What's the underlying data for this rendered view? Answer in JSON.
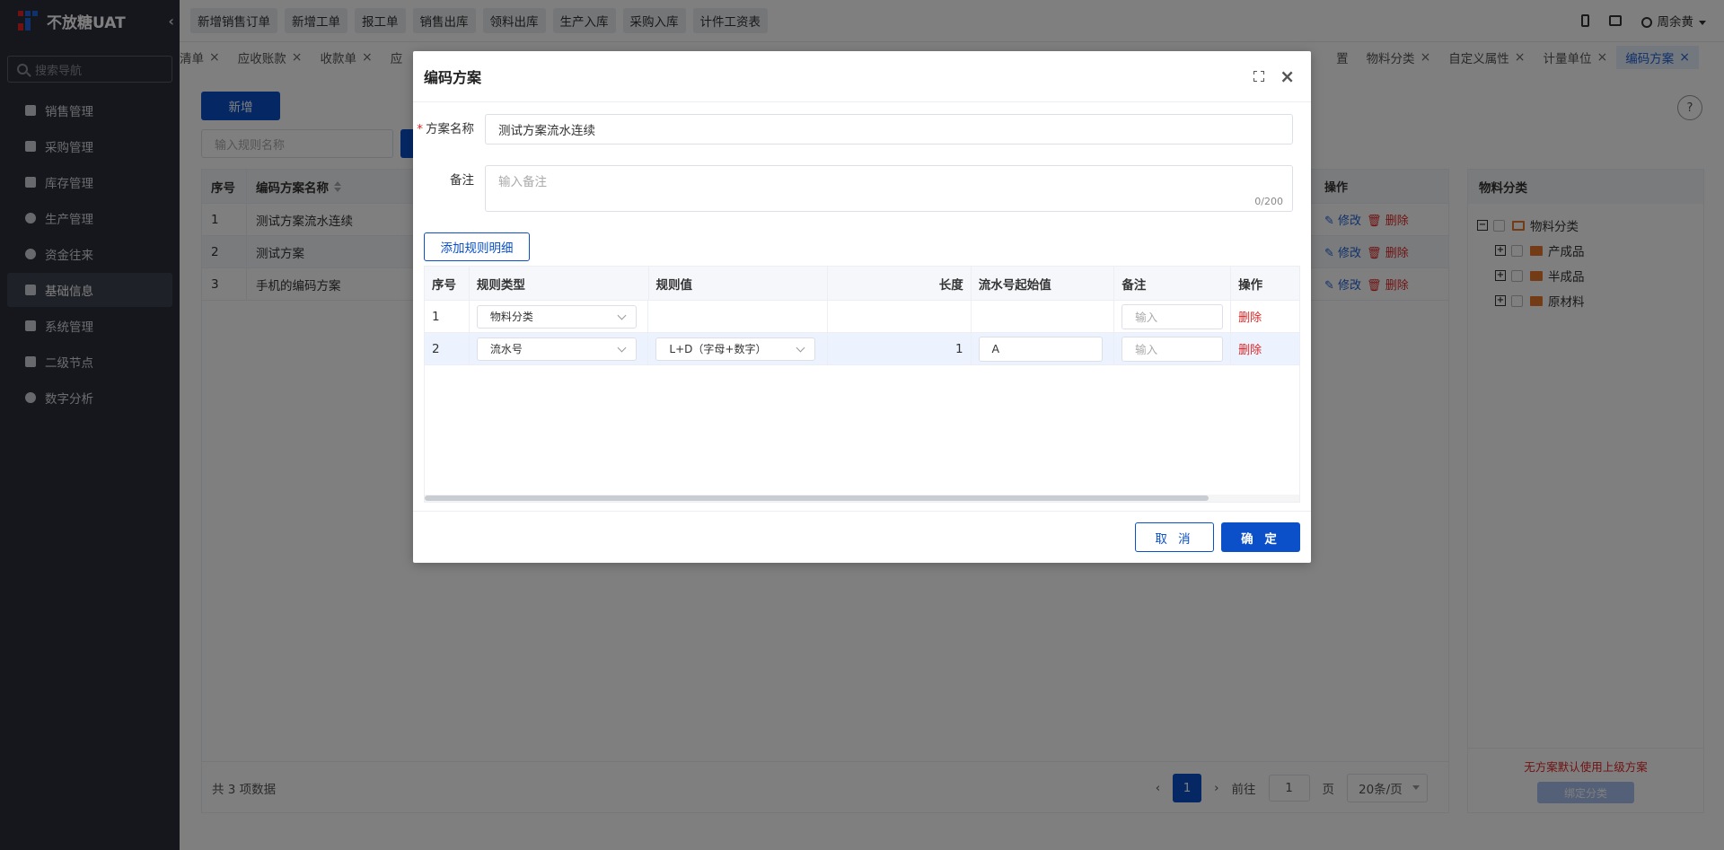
{
  "app": {
    "title": "不放糖UAT"
  },
  "sidebar": {
    "search_placeholder": "搜索导航",
    "items": [
      {
        "label": "销售管理",
        "icon": "tag-icon"
      },
      {
        "label": "采购管理",
        "icon": "cart-icon"
      },
      {
        "label": "库存管理",
        "icon": "warehouse-icon"
      },
      {
        "label": "生产管理",
        "icon": "production-icon"
      },
      {
        "label": "资金往来",
        "icon": "money-icon"
      },
      {
        "label": "基础信息",
        "icon": "grid-icon",
        "active": true
      },
      {
        "label": "系统管理",
        "icon": "apps-icon"
      },
      {
        "label": "二级节点",
        "icon": "document-icon"
      },
      {
        "label": "数字分析",
        "icon": "pie-chart-icon"
      }
    ]
  },
  "topbar": {
    "quick_buttons": [
      "新增销售订单",
      "新增工单",
      "报工单",
      "销售出库",
      "领料出库",
      "生产入库",
      "采购入库",
      "计件工资表"
    ],
    "user_name": "周余黄"
  },
  "tabs": {
    "items": [
      "清单",
      "应收账款",
      "收款单",
      "应",
      "置",
      "物料分类",
      "自定义属性",
      "计量单位",
      "编码方案"
    ],
    "active": "编码方案"
  },
  "main": {
    "add_button": "新增",
    "search_placeholder": "输入规则名称",
    "help": "?",
    "table": {
      "headers": {
        "no": "序号",
        "name": "编码方案名称",
        "op": "操作"
      },
      "rows": [
        {
          "no": "1",
          "name": "测试方案流水连续"
        },
        {
          "no": "2",
          "name": "测试方案"
        },
        {
          "no": "3",
          "name": "手机的编码方案"
        }
      ],
      "edit_label": "修改",
      "delete_label": "删除"
    },
    "footer": {
      "total": "共 3 项数据",
      "page": "1",
      "goto_prefix": "前往",
      "goto_value": "1",
      "goto_suffix": "页",
      "page_size": "20条/页"
    },
    "tree": {
      "title": "物料分类",
      "root": "物料分类",
      "children": [
        "产成品",
        "半成品",
        "原材料"
      ],
      "note": "无方案默认使用上级方案",
      "bind_button": "绑定分类"
    }
  },
  "dialog": {
    "title": "编码方案",
    "scheme_name_label": "方案名称",
    "scheme_name_value": "测试方案流水连续",
    "remark_label": "备注",
    "remark_placeholder": "输入备注",
    "remark_counter": "0/200",
    "add_rule_button": "添加规则明细",
    "rule_table": {
      "headers": {
        "no": "序号",
        "type": "规则类型",
        "value": "规则值",
        "length": "长度",
        "start": "流水号起始值",
        "remark": "备注",
        "op": "操作"
      },
      "rows": [
        {
          "no": "1",
          "type": "物料分类",
          "value": "",
          "length": "",
          "start": "",
          "remark_placeholder": "输入",
          "op": "删除"
        },
        {
          "no": "2",
          "type": "流水号",
          "value": "L+D（字母+数字）",
          "length": "1",
          "start": "A",
          "remark_placeholder": "输入",
          "op": "删除"
        }
      ]
    },
    "cancel_button": "取 消",
    "ok_button": "确 定"
  }
}
